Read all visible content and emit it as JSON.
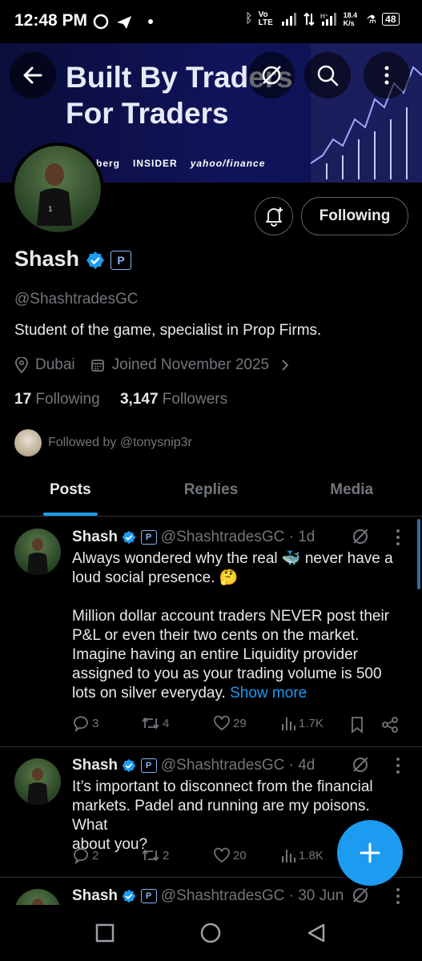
{
  "status_bar": {
    "time": "12:48 PM",
    "network": "Vo LTE",
    "speed": "18.4 K/s",
    "battery": "48"
  },
  "banner": {
    "title_line1": "Built By Traders",
    "title_line2": "For Traders",
    "logos": [
      "berg",
      "INSIDER",
      "yahoo/finance"
    ]
  },
  "profile": {
    "name": "Shash",
    "handle": "@ShashtradesGC",
    "bio": "Student of the game, specialist in Prop Firms.",
    "location": "Dubai",
    "joined": "Joined November 2025",
    "following_count": "17",
    "following_label": "Following",
    "followers_count": "3,147",
    "followers_label": "Followers",
    "followed_by": "Followed by @tonysnip3r",
    "follow_button": "Following"
  },
  "tabs": [
    {
      "label": "Posts",
      "active": true
    },
    {
      "label": "Replies",
      "active": false
    },
    {
      "label": "Media",
      "active": false
    }
  ],
  "tweets": [
    {
      "name": "Shash",
      "handle": "@ShashtradesGC",
      "time": "· 1d",
      "lines": [
        "Always wondered why the real 🐳 never have a",
        "loud social presence. 🤔",
        "",
        "Million dollar account traders NEVER post their",
        "P&L or even their two cents on the market.",
        "Imagine having an entire Liquidity provider",
        "assigned to you as your trading volume is 500",
        "lots on silver everyday."
      ],
      "show_more": "Show more",
      "replies": "3",
      "reposts": "4",
      "likes": "29",
      "views": "1.7K"
    },
    {
      "name": "Shash",
      "handle": "@ShashtradesGC",
      "time": "· 4d",
      "lines": [
        "It’s important to disconnect from the financial",
        "markets. Padel and running are my poisons. What",
        "about you?"
      ],
      "replies": "2",
      "reposts": "2",
      "likes": "20",
      "views": "1.8K"
    },
    {
      "name": "Shash",
      "handle": "@ShashtradesGC",
      "time": "· 30 Jun"
    }
  ],
  "colors": {
    "accent": "#1d9bf0",
    "text": "#e7e9ea",
    "muted": "#71767b",
    "border": "#2f3336"
  }
}
